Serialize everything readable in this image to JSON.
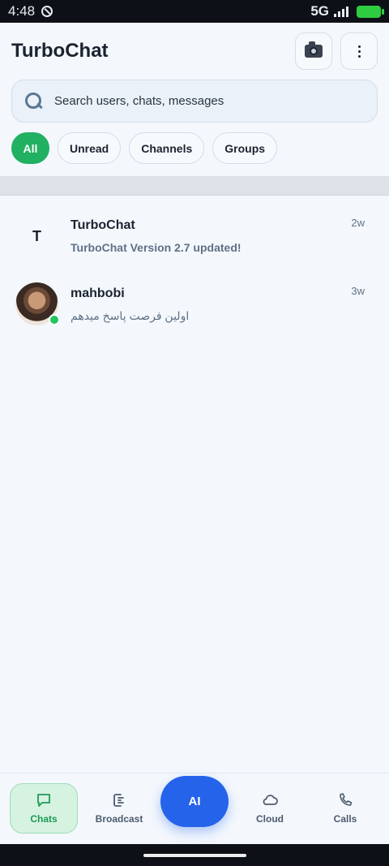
{
  "status_bar": {
    "time": "4:48",
    "network": "5G"
  },
  "header": {
    "title": "TurboChat",
    "camera_icon": "camera-icon",
    "menu_icon": "more-vertical-icon"
  },
  "search": {
    "placeholder": "Search users, chats, messages",
    "icon": "search-icon"
  },
  "filters": [
    {
      "label": "All",
      "active": true
    },
    {
      "label": "Unread",
      "active": false
    },
    {
      "label": "Channels",
      "active": false
    },
    {
      "label": "Groups",
      "active": false
    }
  ],
  "chats": [
    {
      "name": "TurboChat",
      "avatar_letter": "T",
      "preview": "TurboChat Version 2.7 updated!",
      "time": "2w",
      "online": false
    },
    {
      "name": "mahbobi",
      "avatar_letter": "",
      "preview": "اولین فرصت پاسخ میدهم",
      "time": "3w",
      "online": true
    }
  ],
  "bottom_nav": {
    "chats": "Chats",
    "broadcast": "Broadcast",
    "ai": "AI",
    "cloud": "Cloud",
    "calls": "Calls"
  },
  "colors": {
    "accent_green": "#22b062",
    "ai_blue": "#2563eb",
    "online": "#22c55e"
  }
}
